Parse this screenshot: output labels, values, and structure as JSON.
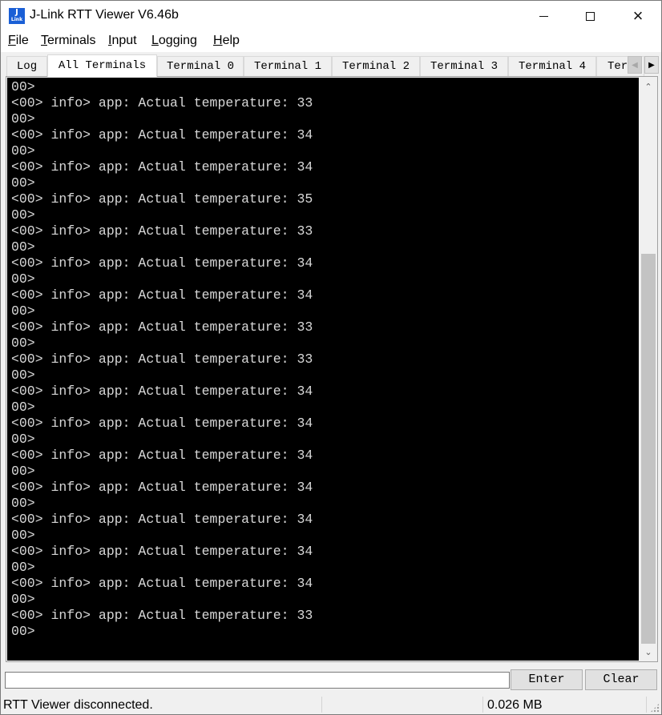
{
  "window": {
    "title": "J-Link RTT Viewer V6.46b",
    "app_icon": {
      "line1": "J",
      "line2": "Link"
    },
    "controls": {
      "minimize": "minimize-icon",
      "maximize": "maximize-icon",
      "close": "×"
    }
  },
  "menu": [
    {
      "mnemonic": "F",
      "rest": "ile"
    },
    {
      "mnemonic": "T",
      "rest": "erminals"
    },
    {
      "mnemonic": "I",
      "rest": "nput"
    },
    {
      "mnemonic": "L",
      "rest": "ogging"
    },
    {
      "mnemonic": "H",
      "rest": "elp"
    }
  ],
  "tabs": [
    {
      "label": "Log",
      "active": false
    },
    {
      "label": "All Terminals",
      "active": true
    },
    {
      "label": "Terminal 0",
      "active": false
    },
    {
      "label": "Terminal 1",
      "active": false
    },
    {
      "label": "Terminal 2",
      "active": false
    },
    {
      "label": "Terminal 3",
      "active": false
    },
    {
      "label": "Terminal 4",
      "active": false
    },
    {
      "label": "Ter",
      "active": false
    }
  ],
  "tab_scroll": {
    "left": "◀",
    "right": "▶"
  },
  "terminal": {
    "lines": [
      "00>",
      "<00> info> app: Actual temperature: 33",
      "00>",
      "<00> info> app: Actual temperature: 34",
      "00>",
      "<00> info> app: Actual temperature: 34",
      "00>",
      "<00> info> app: Actual temperature: 35",
      "00>",
      "<00> info> app: Actual temperature: 33",
      "00>",
      "<00> info> app: Actual temperature: 34",
      "00>",
      "<00> info> app: Actual temperature: 34",
      "00>",
      "<00> info> app: Actual temperature: 33",
      "00>",
      "<00> info> app: Actual temperature: 33",
      "00>",
      "<00> info> app: Actual temperature: 34",
      "00>",
      "<00> info> app: Actual temperature: 34",
      "00>",
      "<00> info> app: Actual temperature: 34",
      "00>",
      "<00> info> app: Actual temperature: 34",
      "00>",
      "<00> info> app: Actual temperature: 34",
      "00>",
      "<00> info> app: Actual temperature: 34",
      "00>",
      "<00> info> app: Actual temperature: 34",
      "00>",
      "<00> info> app: Actual temperature: 33",
      "00>"
    ],
    "scroll": {
      "thumb_start_fraction": 0.29,
      "thumb_end_fraction": 1.0,
      "up": "⌃",
      "down": "⌄"
    }
  },
  "input": {
    "value": "",
    "placeholder": ""
  },
  "buttons": {
    "enter": "Enter",
    "clear": "Clear"
  },
  "status": {
    "message": "RTT Viewer disconnected.",
    "data_size": "0.026 MB"
  }
}
